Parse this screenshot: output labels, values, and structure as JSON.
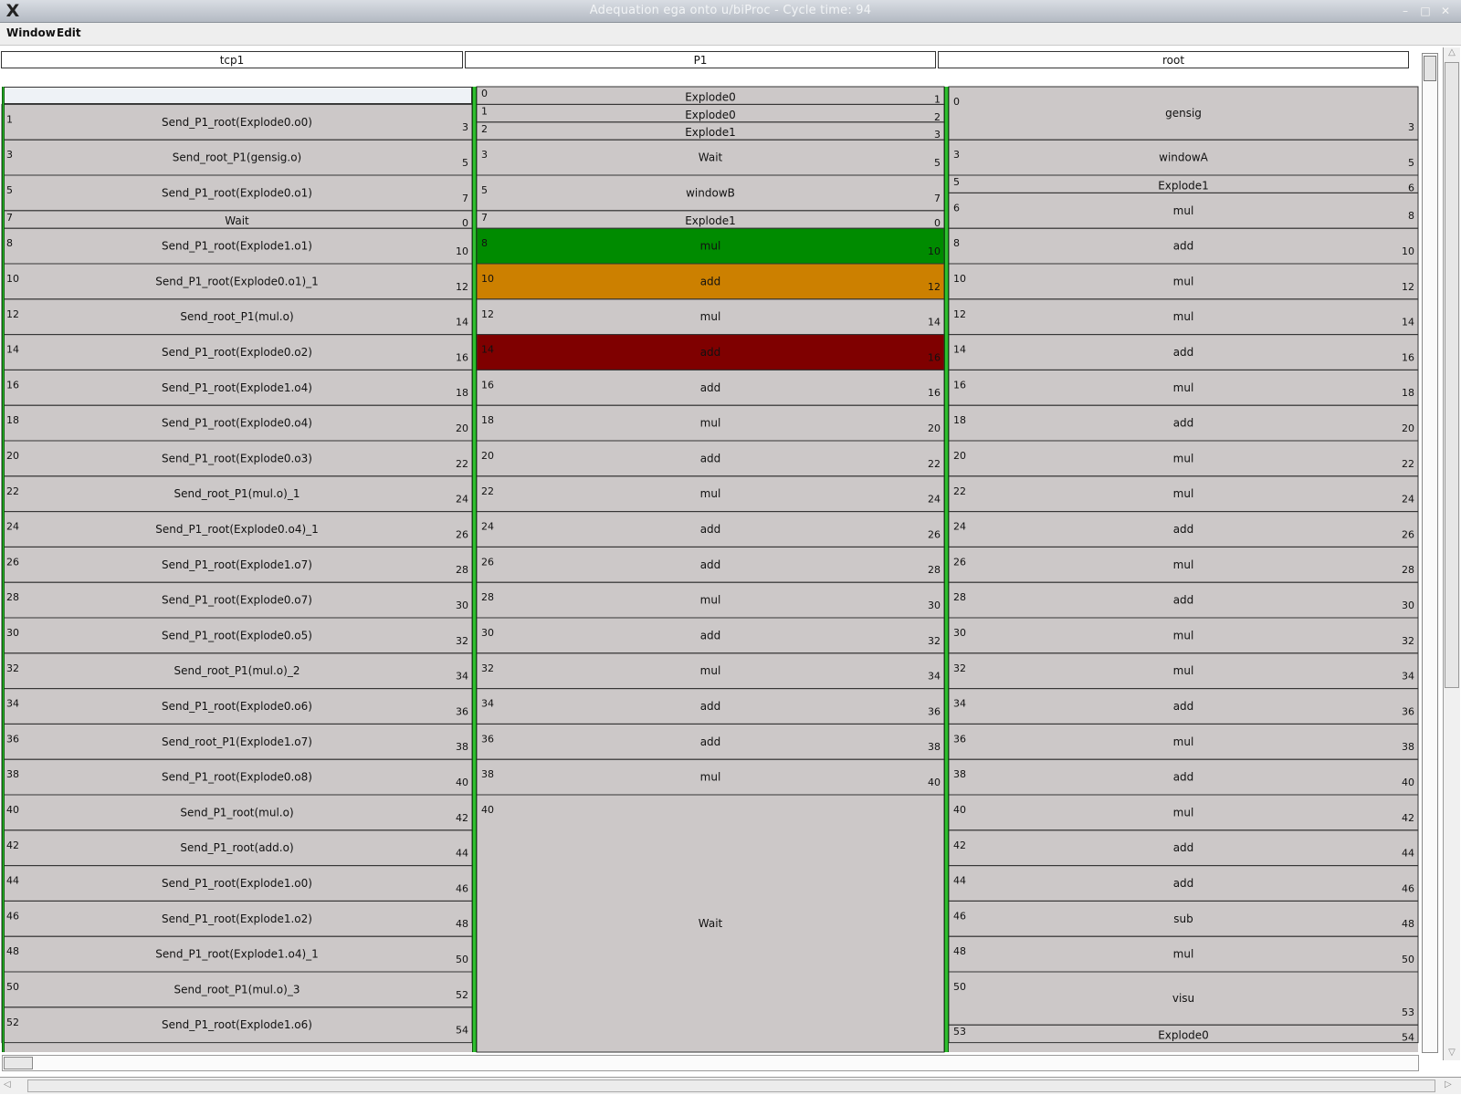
{
  "window": {
    "title": "Adequation ega onto u/biProc - Cycle time: 94",
    "app_icon": "X",
    "minimize_glyph": "–",
    "maximize_glyph": "□",
    "close_glyph": "✕"
  },
  "menu": {
    "window": "Window",
    "edit": "Edit"
  },
  "headers": {
    "tcp1": "tcp1",
    "p1": "P1",
    "root": "root"
  },
  "colors": {
    "background": "#ccc8c8",
    "green": "#008b00",
    "orange": "#cc8000",
    "dark_red": "#7f0000",
    "separator_green": "#2fbf2f"
  },
  "chart_data": {
    "type": "gantt",
    "title": "",
    "time_range": [
      0,
      55
    ],
    "lanes": [
      {
        "name": "tcp1",
        "blocks": [
          {
            "start": 1,
            "end": 3,
            "label": "Send_P1_root(Explode0.o0)"
          },
          {
            "start": 3,
            "end": 5,
            "label": "Send_root_P1(gensig.o)"
          },
          {
            "start": 5,
            "end": 7,
            "label": "Send_P1_root(Explode0.o1)"
          },
          {
            "start": 7,
            "end": 8,
            "label": "Wait",
            "start_label": "7",
            "end_label": "0"
          },
          {
            "start": 8,
            "end": 10,
            "label": "Send_P1_root(Explode1.o1)"
          },
          {
            "start": 10,
            "end": 12,
            "label": "Send_P1_root(Explode0.o1)_1"
          },
          {
            "start": 12,
            "end": 14,
            "label": "Send_root_P1(mul.o)"
          },
          {
            "start": 14,
            "end": 16,
            "label": "Send_P1_root(Explode0.o2)"
          },
          {
            "start": 16,
            "end": 18,
            "label": "Send_P1_root(Explode1.o4)"
          },
          {
            "start": 18,
            "end": 20,
            "label": "Send_P1_root(Explode0.o4)"
          },
          {
            "start": 20,
            "end": 22,
            "label": "Send_P1_root(Explode0.o3)"
          },
          {
            "start": 22,
            "end": 24,
            "label": "Send_root_P1(mul.o)_1"
          },
          {
            "start": 24,
            "end": 26,
            "label": "Send_P1_root(Explode0.o4)_1"
          },
          {
            "start": 26,
            "end": 28,
            "label": "Send_P1_root(Explode1.o7)"
          },
          {
            "start": 28,
            "end": 30,
            "label": "Send_P1_root(Explode0.o7)"
          },
          {
            "start": 30,
            "end": 32,
            "label": "Send_P1_root(Explode0.o5)"
          },
          {
            "start": 32,
            "end": 34,
            "label": "Send_root_P1(mul.o)_2"
          },
          {
            "start": 34,
            "end": 36,
            "label": "Send_P1_root(Explode0.o6)"
          },
          {
            "start": 36,
            "end": 38,
            "label": "Send_root_P1(Explode1.o7)"
          },
          {
            "start": 38,
            "end": 40,
            "label": "Send_P1_root(Explode0.o8)"
          },
          {
            "start": 40,
            "end": 42,
            "label": "Send_P1_root(mul.o)"
          },
          {
            "start": 42,
            "end": 44,
            "label": "Send_P1_root(add.o)"
          },
          {
            "start": 44,
            "end": 46,
            "label": "Send_P1_root(Explode1.o0)"
          },
          {
            "start": 46,
            "end": 48,
            "label": "Send_P1_root(Explode1.o2)"
          },
          {
            "start": 48,
            "end": 50,
            "label": "Send_P1_root(Explode1.o4)_1"
          },
          {
            "start": 50,
            "end": 52,
            "label": "Send_root_P1(mul.o)_3"
          },
          {
            "start": 52,
            "end": 54,
            "label": "Send_P1_root(Explode1.o6)"
          }
        ]
      },
      {
        "name": "P1",
        "blocks": [
          {
            "start": 0,
            "end": 1,
            "label": "Explode0"
          },
          {
            "start": 1,
            "end": 2,
            "label": "Explode0"
          },
          {
            "start": 2,
            "end": 3,
            "label": "Explode1"
          },
          {
            "start": 3,
            "end": 5,
            "label": "Wait"
          },
          {
            "start": 5,
            "end": 7,
            "label": "windowB"
          },
          {
            "start": 7,
            "end": 8,
            "label": "Explode1",
            "start_label": "7",
            "end_label": "0"
          },
          {
            "start": 8,
            "end": 10,
            "label": "mul",
            "color": "green"
          },
          {
            "start": 10,
            "end": 12,
            "label": "add",
            "color": "orange"
          },
          {
            "start": 12,
            "end": 14,
            "label": "mul"
          },
          {
            "start": 14,
            "end": 16,
            "label": "add",
            "color": "dark_red"
          },
          {
            "start": 16,
            "end": 18,
            "label": "add",
            "start_label": "16",
            "end_label": "16"
          },
          {
            "start": 18,
            "end": 20,
            "label": "mul"
          },
          {
            "start": 20,
            "end": 22,
            "label": "add"
          },
          {
            "start": 22,
            "end": 24,
            "label": "mul"
          },
          {
            "start": 24,
            "end": 26,
            "label": "add"
          },
          {
            "start": 26,
            "end": 28,
            "label": "add"
          },
          {
            "start": 28,
            "end": 30,
            "label": "mul"
          },
          {
            "start": 30,
            "end": 32,
            "label": "add"
          },
          {
            "start": 32,
            "end": 34,
            "label": "mul"
          },
          {
            "start": 34,
            "end": 36,
            "label": "add"
          },
          {
            "start": 36,
            "end": 38,
            "label": "add"
          },
          {
            "start": 38,
            "end": 40,
            "label": "mul"
          },
          {
            "start": 40,
            "end": 55,
            "label": "Wait",
            "end_label": ""
          }
        ]
      },
      {
        "name": "root",
        "blocks": [
          {
            "start": 0,
            "end": 3,
            "label": "gensig"
          },
          {
            "start": 3,
            "end": 5,
            "label": "windowA"
          },
          {
            "start": 5,
            "end": 6,
            "label": "Explode1"
          },
          {
            "start": 6,
            "end": 8,
            "label": "mul"
          },
          {
            "start": 8,
            "end": 10,
            "label": "add"
          },
          {
            "start": 10,
            "end": 12,
            "label": "mul"
          },
          {
            "start": 12,
            "end": 14,
            "label": "mul"
          },
          {
            "start": 14,
            "end": 16,
            "label": "add"
          },
          {
            "start": 16,
            "end": 18,
            "label": "mul"
          },
          {
            "start": 18,
            "end": 20,
            "label": "add"
          },
          {
            "start": 20,
            "end": 22,
            "label": "mul"
          },
          {
            "start": 22,
            "end": 24,
            "label": "mul"
          },
          {
            "start": 24,
            "end": 26,
            "label": "add"
          },
          {
            "start": 26,
            "end": 28,
            "label": "mul"
          },
          {
            "start": 28,
            "end": 30,
            "label": "add"
          },
          {
            "start": 30,
            "end": 32,
            "label": "mul"
          },
          {
            "start": 32,
            "end": 34,
            "label": "mul"
          },
          {
            "start": 34,
            "end": 36,
            "label": "add"
          },
          {
            "start": 36,
            "end": 38,
            "label": "mul"
          },
          {
            "start": 38,
            "end": 40,
            "label": "add"
          },
          {
            "start": 40,
            "end": 42,
            "label": "mul"
          },
          {
            "start": 42,
            "end": 44,
            "label": "add"
          },
          {
            "start": 44,
            "end": 46,
            "label": "add"
          },
          {
            "start": 46,
            "end": 48,
            "label": "sub"
          },
          {
            "start": 48,
            "end": 50,
            "label": "mul"
          },
          {
            "start": 50,
            "end": 53,
            "label": "visu"
          },
          {
            "start": 53,
            "end": 54,
            "label": "Explode0"
          }
        ]
      }
    ]
  }
}
